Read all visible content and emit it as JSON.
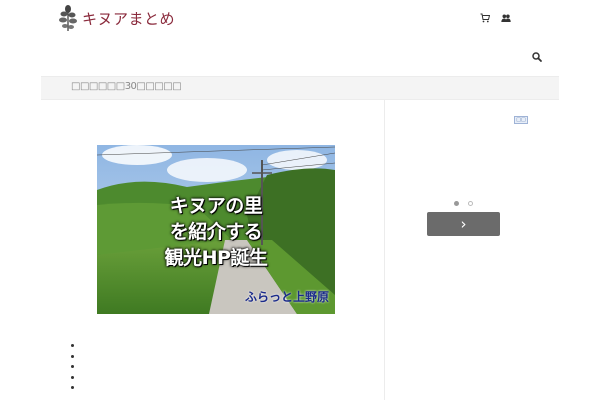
{
  "site": {
    "logo_text": "キヌアまとめ"
  },
  "header": {
    "cart_icon": "cart-icon",
    "user_icon": "users-icon",
    "search_icon": "search-icon"
  },
  "breadcrumb": {
    "text": "□□□□□□30□□□□□"
  },
  "article": {
    "image": {
      "headline_lines": [
        "キヌアの里",
        "を紹介する",
        "観光HP誕生"
      ],
      "sign_text": "ふらっと上野原"
    },
    "bullet_count": 5
  },
  "sidebar": {
    "ad_badge": "□□",
    "slider_dots": 2,
    "active_dot": 0,
    "next_label": "›"
  }
}
